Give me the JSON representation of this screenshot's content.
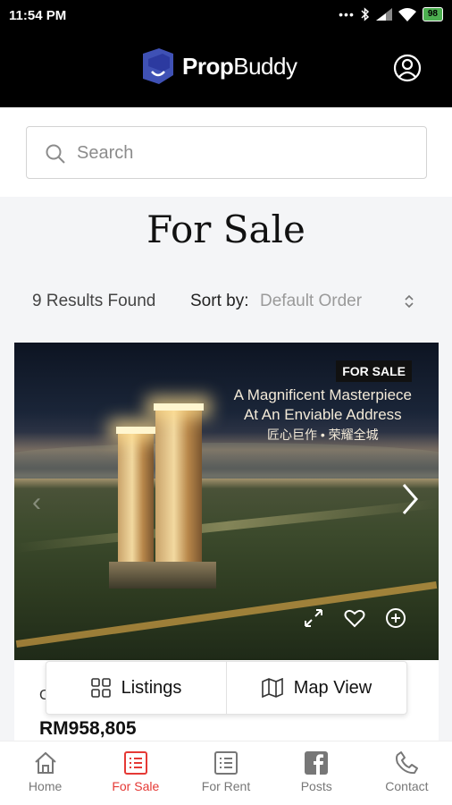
{
  "status_bar": {
    "time": "11:54 PM",
    "battery": "98"
  },
  "header": {
    "brand_bold": "Prop",
    "brand_rest": "Buddy",
    "logo_letter": "U"
  },
  "search": {
    "placeholder": "Search"
  },
  "page": {
    "title": "For Sale"
  },
  "results": {
    "count_text": "9 Results Found",
    "sort_label": "Sort by:",
    "sort_value": "Default Order"
  },
  "listing": {
    "badge": "FOR SALE",
    "tagline_line1": "A Magnificent Masterpiece",
    "tagline_line2": "At An Enviable Address",
    "tagline_cn": "匠心巨作 • 荣耀全城",
    "title_partial": "C",
    "price": "RM958,805"
  },
  "view_toggle": {
    "listings_label": "Listings",
    "map_label": "Map View"
  },
  "bottom_nav": {
    "items": [
      {
        "label": "Home",
        "icon": "home-icon",
        "active": false
      },
      {
        "label": "For Sale",
        "icon": "list-icon",
        "active": true
      },
      {
        "label": "For Rent",
        "icon": "list-icon",
        "active": false
      },
      {
        "label": "Posts",
        "icon": "facebook-icon",
        "active": false
      },
      {
        "label": "Contact",
        "icon": "phone-icon",
        "active": false
      }
    ]
  },
  "colors": {
    "accent": "#e53935",
    "header_bg": "#000000",
    "logo_blue": "#3f51b5"
  }
}
